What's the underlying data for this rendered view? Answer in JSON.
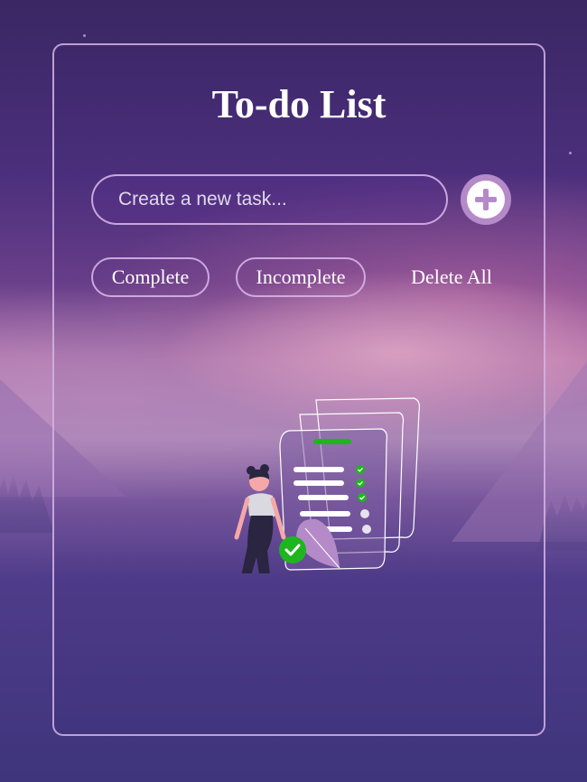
{
  "app": {
    "title": "To-do List"
  },
  "task_input": {
    "placeholder": "Create a new task...",
    "value": ""
  },
  "add_button": {
    "icon": "plus-icon"
  },
  "filters": {
    "complete_label": "Complete",
    "incomplete_label": "Incomplete",
    "delete_all_label": "Delete All"
  },
  "illustration": {
    "icon": "empty-list-illustration"
  },
  "colors": {
    "accent": "#b58ac8",
    "check_green": "#1fb51f",
    "border": "#d6b4e6"
  }
}
